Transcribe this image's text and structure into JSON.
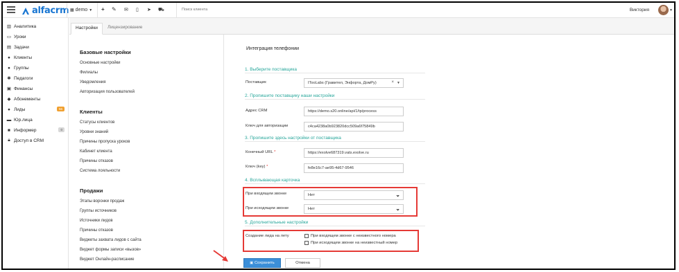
{
  "topbar": {
    "logo_text": "alfacrm",
    "branch": "demo",
    "search_placeholder": "Поиск клиента",
    "user_name": "Виктория",
    "icons": [
      "plus-icon",
      "wrench-icon",
      "envelope-icon",
      "phone-icon",
      "telegram-icon",
      "cart-icon"
    ]
  },
  "sidebar": {
    "items": [
      {
        "label": "Аналитика",
        "icon": "chart-icon"
      },
      {
        "label": "Уроки",
        "icon": "calendar-icon"
      },
      {
        "label": "Задачи",
        "icon": "tasks-icon"
      },
      {
        "label": "Клиенты",
        "icon": "user-icon"
      },
      {
        "label": "Группы",
        "icon": "users-icon"
      },
      {
        "label": "Педагоги",
        "icon": "teacher-icon"
      },
      {
        "label": "Финансы",
        "icon": "money-icon"
      },
      {
        "label": "Абонементы",
        "icon": "tag-icon"
      },
      {
        "label": "Лиды",
        "icon": "user-plus-icon",
        "badge": "56",
        "badge_color": "#f0a030"
      },
      {
        "label": "Юр.лица",
        "icon": "building-icon"
      },
      {
        "label": "Информер",
        "icon": "info-icon",
        "badge": "0",
        "badge_color": "#d8d8d8"
      },
      {
        "label": "Доступ в CRM",
        "icon": "lock-icon"
      }
    ]
  },
  "tabs": {
    "active": "Настройки",
    "inactive": "Лицензирование"
  },
  "settings_nav": {
    "groups": [
      {
        "title": "Базовые настройки",
        "links": [
          "Основные настройки",
          "Филиалы",
          "Уведомления",
          "Авторизация пользователей"
        ]
      },
      {
        "title": "Клиенты",
        "links": [
          "Статусы клиентов",
          "Уровни знаний",
          "Причины пропуска уроков",
          "Кабинет клиента",
          "Причины отказов",
          "Система лояльности"
        ]
      },
      {
        "title": "Продажи",
        "links": [
          "Этапы воронки продаж",
          "Группы источников",
          "Источники лидов",
          "Причины отказов",
          "Виджеты захвата лидов с сайта",
          "Виджет формы записи «вызов»",
          "Виджет Онлайн-расписание"
        ]
      }
    ]
  },
  "main": {
    "title": "Интеграция телефонии",
    "s1": "1. Выберите поставщика",
    "provider_label": "Поставщик",
    "provider_value": "ITooLabs (Гравител, Энфорта, ДомРу)",
    "s2": "2. Пропишите поставщику наши настройки",
    "crm_address_label": "Адрес CRM",
    "crm_address_value": "https://demo.s20.online/api/1/tp/process",
    "auth_key_label": "Ключ для авторизации",
    "auth_key_value": "c4ca4238a0b923820dcc509a6f75849b",
    "s3": "3. Пропишите здесь настройки от поставщика",
    "endpoint_label": "Конечный URL",
    "endpoint_value": "https://exolve687319.vats.exolve.ru",
    "key_label": "Ключ (key)",
    "key_value": "fe8e16c7-ae95-4d67-9546",
    "s4": "4. Всплывающая карточка",
    "incoming_label": "При входящем звонке",
    "incoming_value": "Нет",
    "outgoing_label": "При исходящем звонке",
    "outgoing_value": "Нет",
    "s5": "5. Дополнительные настройки",
    "create_lead_label": "Создание лида на лету",
    "cb_incoming": "При входящем звонке с неизвестного номера",
    "cb_outgoing": "При исходящем звонке на неизвестный номер",
    "save": "Сохранить",
    "cancel": "Отмена",
    "highlight_color": "#e53935",
    "section_color": "#26a69a"
  }
}
